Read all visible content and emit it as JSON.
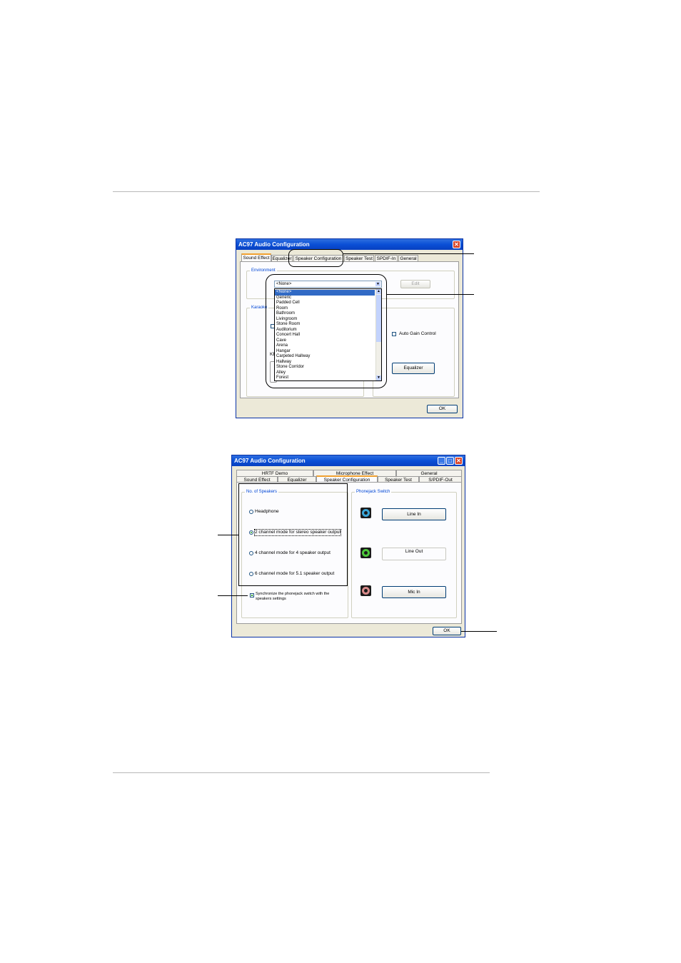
{
  "dialog1": {
    "title": "AC97 Audio Configuration",
    "tabs": [
      "Sound Effect",
      "Equalizer",
      "Speaker Configuration",
      "Speaker Test",
      "SPDIF-In",
      "General"
    ],
    "environment_label": "Environment",
    "environment_selected": "<None>",
    "edit_button": "Edit",
    "karaoke_label": "Karaoke",
    "ke_label": "KE",
    "environment_options": [
      "<None>",
      "Generic",
      "Padded Cell",
      "Room",
      "Bathroom",
      "Livingroom",
      "Stone Room",
      "Auditorium",
      "Concert Hall",
      "Cave",
      "Arena",
      "Hangar",
      "Carpeted Hallway",
      "Hallway",
      "Stone Corridor",
      "Alley",
      "Forest"
    ],
    "auto_gain_label": "Auto Gain Control",
    "equalizer_button": "Equalizer",
    "ok_button": "OK"
  },
  "dialog2": {
    "title": "AC97 Audio Configuration",
    "tabs_row1": [
      "HRTF Demo",
      "Microphone Effect",
      "General"
    ],
    "tabs_row2": [
      "Sound Effect",
      "Equalizer",
      "Speaker Configuration",
      "Speaker Test",
      "S/PDIF-Out"
    ],
    "speakers_group": "No. of Speakers",
    "radio_options": [
      "Headphone",
      "2 channel mode for stereo speaker output",
      "4 channel mode for 4 speaker output",
      "6 channel mode for 5.1 speaker output"
    ],
    "selected_radio": 1,
    "sync_checkbox": "Synchronize the phonejack switch with the speakers settings",
    "phonejack_group": "Phonejack Switch",
    "jacks": [
      "Line In",
      "Line Out",
      "Mic In"
    ],
    "jack_colors": [
      "#3aa6d8",
      "#4cc83a",
      "#d88a8a"
    ],
    "ok_button": "OK"
  }
}
